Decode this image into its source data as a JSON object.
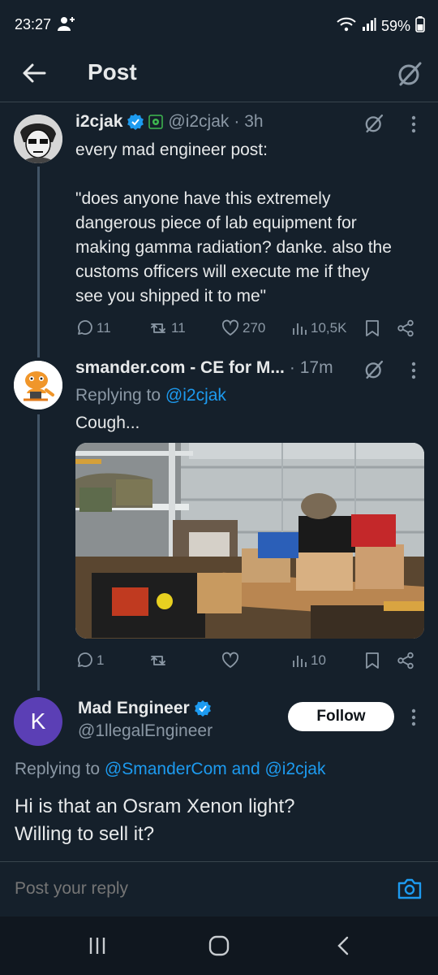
{
  "status": {
    "time": "23:27",
    "battery": "59%"
  },
  "header": {
    "title": "Post"
  },
  "tweet1": {
    "name": "i2cjak",
    "handle": "@i2cjak",
    "dot_time": "· 3h",
    "line1": "every mad engineer post:",
    "quote_lines": [
      "\"does anyone have this extremely",
      "dangerous piece of lab equipment for",
      "making gamma radiation? danke. also the",
      "customs officers will execute me if they",
      "see you shipped it to me\""
    ],
    "replies": "11",
    "reposts": "11",
    "likes": "270",
    "views": "10,5K"
  },
  "tweet2": {
    "name": "smander.com - CE for M...",
    "dot_time": "· 17m",
    "replying_prefix": "Replying to",
    "replying_handle": "@i2cjak",
    "text": "Cough...",
    "replies": "1",
    "views": "10"
  },
  "tweet3": {
    "avatar_letter": "K",
    "name": "Mad Engineer",
    "handle": "@1llegalEngineer",
    "follow_label": "Follow",
    "replying_prefix": "Replying to",
    "replying_handles": "@SmanderCom and @i2cjak",
    "line1": "Hi is that an Osram Xenon light?",
    "line2": "Willing to sell it?"
  },
  "reply": {
    "placeholder": "Post your reply"
  },
  "colors": {
    "background": "#15202b",
    "accent": "#1d9bf0",
    "muted": "#8b98a5",
    "verified": "#1d9bf0"
  }
}
